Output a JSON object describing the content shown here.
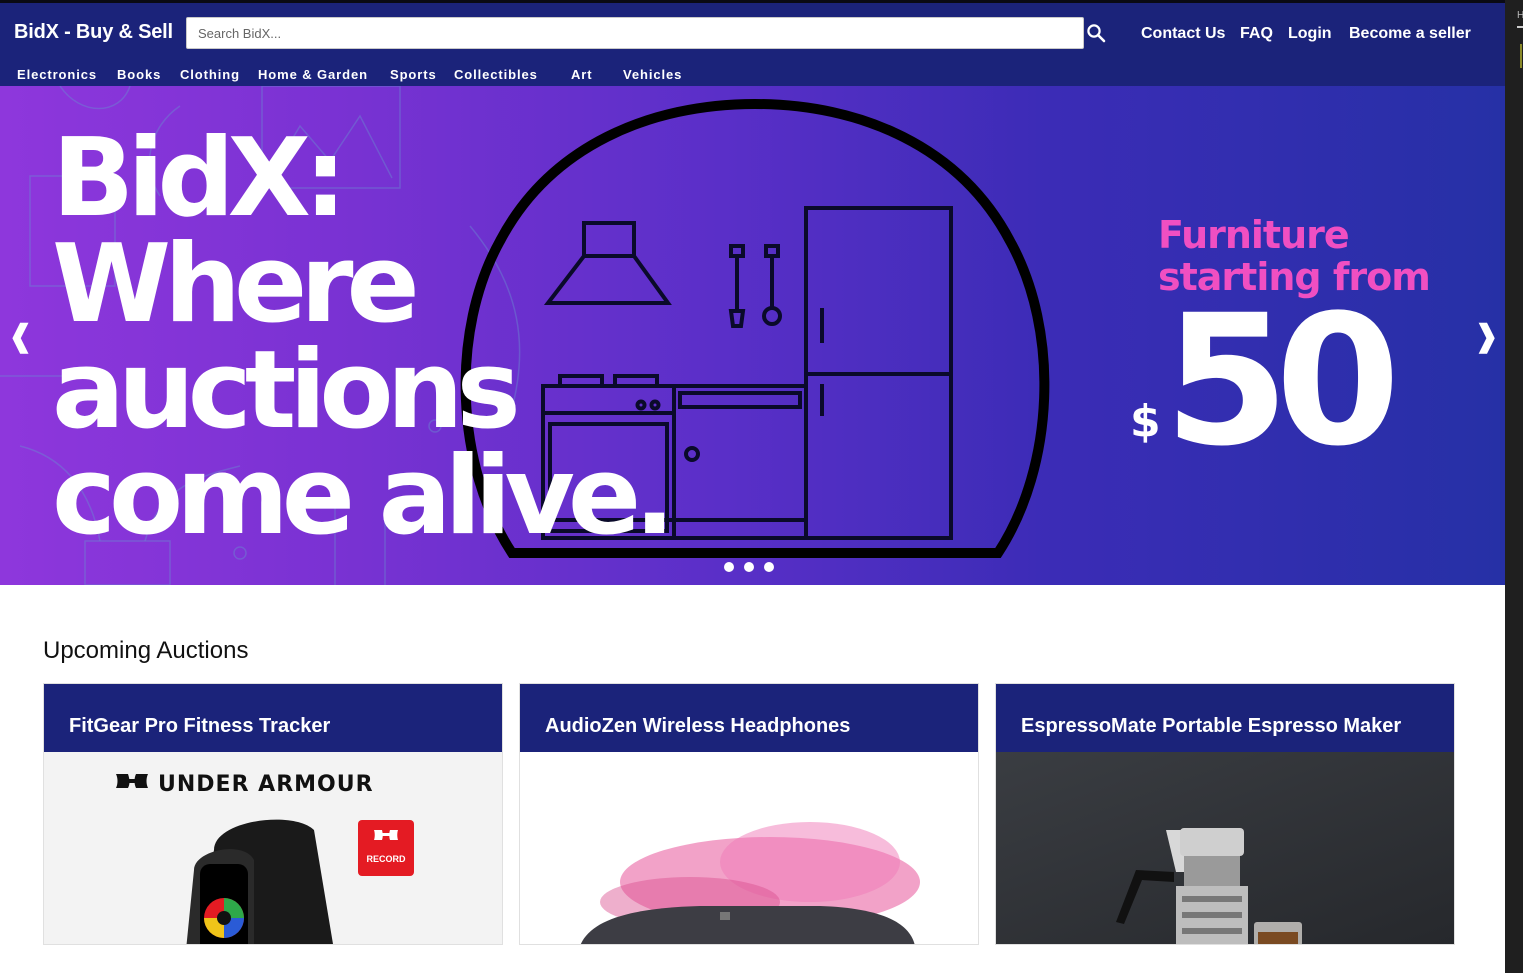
{
  "header": {
    "brand": "BidX - Buy & Sell",
    "search_placeholder": "Search BidX...",
    "links": [
      "Contact Us",
      "FAQ",
      "Login",
      "Become a seller"
    ],
    "categories": [
      "Electronics",
      "Books",
      "Clothing",
      "Home & Garden",
      "Sports",
      "Collectibles",
      "Art",
      "Vehicles"
    ]
  },
  "hero": {
    "headline": [
      "BidX:",
      "Where",
      "auctions",
      "come alive."
    ],
    "promo": [
      "Furniture",
      "starting from"
    ],
    "currency": "$",
    "price": "50",
    "prev": "❰",
    "next": "❱",
    "slides": 3
  },
  "auctions": {
    "title": "Upcoming Auctions",
    "items": [
      {
        "name": "FitGear Pro Fitness Tracker",
        "brand_logo": "UNDER ARMOUR",
        "badge": "RECORD"
      },
      {
        "name": "AudioZen Wireless Headphones"
      },
      {
        "name": "EspressoMate Portable Espresso Maker"
      }
    ]
  },
  "colors": {
    "header": "#1b237a",
    "hero_left": "#8e37dc",
    "hero_right": "#2630a6",
    "promo": "#f04fc2"
  }
}
